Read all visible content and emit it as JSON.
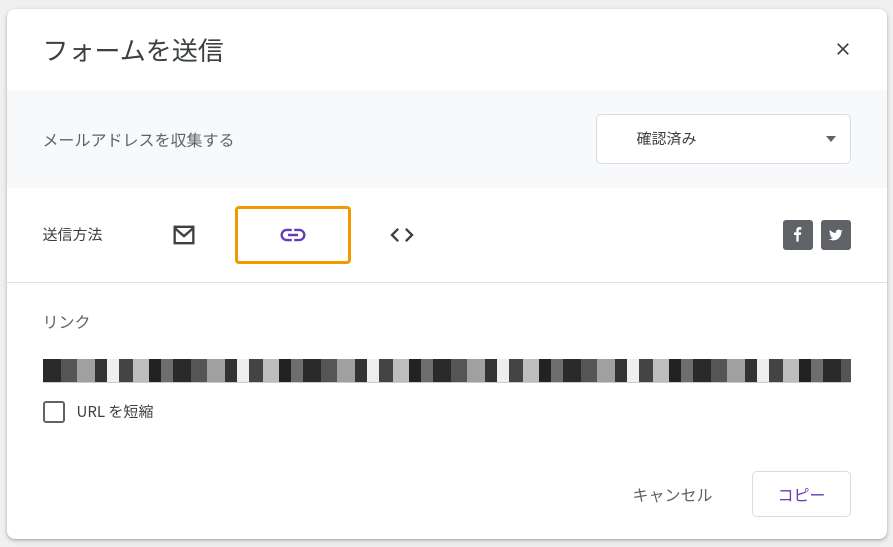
{
  "dialog": {
    "title": "フォームを送信"
  },
  "collect": {
    "label": "メールアドレスを収集する",
    "selected": "確認済み"
  },
  "methods": {
    "label": "送信方法"
  },
  "link": {
    "heading": "リンク",
    "shorten_label": "URL を短縮"
  },
  "actions": {
    "cancel": "キャンセル",
    "copy": "コピー"
  }
}
